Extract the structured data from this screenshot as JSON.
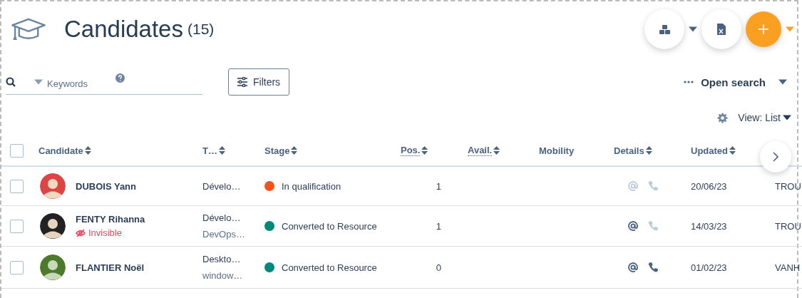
{
  "header": {
    "title": "Candidates",
    "count": "(15)"
  },
  "actions": [
    {
      "kind": "cubes",
      "dropdown": true
    },
    {
      "kind": "sheet",
      "dropdown": false
    },
    {
      "kind": "add",
      "dropdown": true
    }
  ],
  "search": {
    "placeholder": "Keywords"
  },
  "select_all": {
    "checked": false
  },
  "filters_button": "Filters",
  "open_search": "Open search",
  "view": "View: List",
  "table": {
    "columns": [
      {
        "label": "Candidate",
        "sortable": true,
        "underlined": false
      },
      {
        "label": "T…",
        "sortable": true,
        "underlined": false
      },
      {
        "label": "Stage",
        "sortable": true,
        "underlined": false
      },
      {
        "label": "Pos.",
        "sortable": true,
        "underlined": true
      },
      {
        "label": "Avail.",
        "sortable": true,
        "underlined": true
      },
      {
        "label": "Mobility",
        "sortable": false,
        "underlined": false
      },
      {
        "label": "Details",
        "sortable": true,
        "underlined": false
      },
      {
        "label": "Updated",
        "sortable": true,
        "underlined": false
      }
    ],
    "rows": [
      {
        "checked": false,
        "name": "DUBOIS Yann",
        "title": "Dévelo…",
        "stage": "In qualification",
        "color": "#f4511e",
        "positions": "1",
        "email": false,
        "phone": false,
        "updated": "20/06/23",
        "column_10": "TROU"
      },
      {
        "checked": false,
        "name": "FENTY Rihanna",
        "flag": "Invisible",
        "title": "Dévelo…",
        "subtitle": "DevOps…",
        "stage": "Converted to Resource",
        "color": "#00897b",
        "positions": "1",
        "email": true,
        "phone": false,
        "updated": "14/03/23",
        "column_10": "TROU"
      },
      {
        "checked": false,
        "name": "FLANTIER Noël",
        "title": "Deskto…",
        "subtitle": "window…",
        "stage": "Converted to Resource",
        "color": "#00897b",
        "positions": "0",
        "email": true,
        "phone": true,
        "updated": "01/02/23",
        "column_10": "VANH"
      }
    ]
  }
}
